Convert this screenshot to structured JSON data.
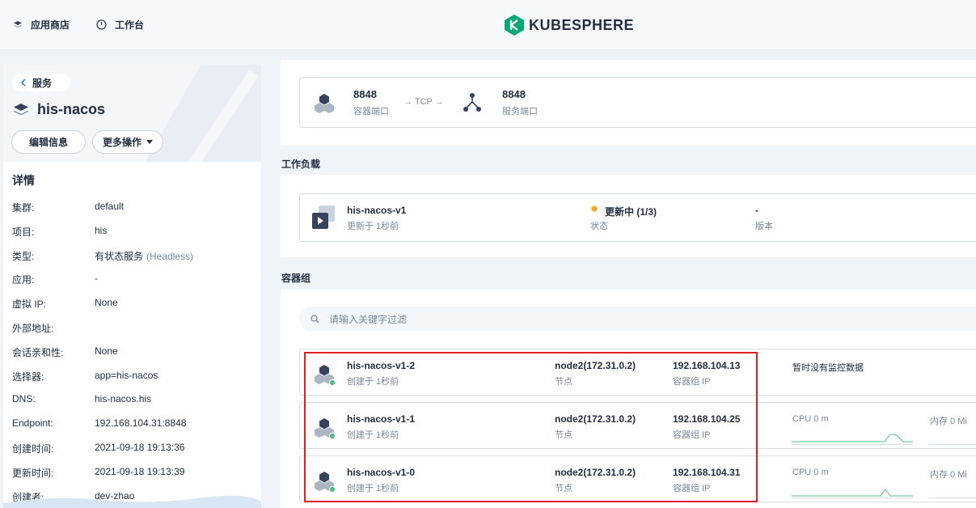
{
  "topbar": {
    "app_store": "应用商店",
    "workbench": "工作台",
    "logo_text": "KUBESPHERE",
    "icons": [
      "layers-icon",
      "dashboard-icon",
      "kubesphere-logo-icon"
    ]
  },
  "sidebar": {
    "back_label": "服务",
    "service_name": "his-nacos",
    "edit_label": "编辑信息",
    "more_label": "更多操作",
    "details_title": "详情",
    "details": [
      {
        "label": "集群:",
        "value": "default",
        "extra": ""
      },
      {
        "label": "项目:",
        "value": "his",
        "extra": ""
      },
      {
        "label": "类型:",
        "value": "有状态服务",
        "extra": "(Headless)"
      },
      {
        "label": "应用:",
        "value": "-",
        "extra": ""
      },
      {
        "label": "虚拟 IP:",
        "value": "None",
        "extra": ""
      },
      {
        "label": "外部地址:",
        "value": "",
        "extra": ""
      },
      {
        "label": "会话亲和性:",
        "value": "None",
        "extra": ""
      },
      {
        "label": "选择器:",
        "value": "app=his-nacos",
        "extra": ""
      },
      {
        "label": "DNS:",
        "value": "his-nacos.his",
        "extra": ""
      },
      {
        "label": "Endpoint:",
        "value": "192.168.104.31:8848",
        "extra": ""
      },
      {
        "label": "创建时间:",
        "value": "2021-09-18 19:13:36",
        "extra": ""
      },
      {
        "label": "更新时间:",
        "value": "2021-09-18 19:13:39",
        "extra": ""
      },
      {
        "label": "创建者:",
        "value": "dev-zhao",
        "extra": ""
      }
    ]
  },
  "ports": {
    "container_port": "8848",
    "container_port_label": "容器端口",
    "protocol": "→ TCP →",
    "service_port": "8848",
    "service_port_label": "服务端口"
  },
  "workload": {
    "section_title": "工作负载",
    "name": "his-nacos-v1",
    "updated": "更新于 1秒前",
    "status": "更新中 (1/3)",
    "status_label": "状态",
    "version": "-",
    "version_label": "版本",
    "status_color": "#f5a623"
  },
  "pods": {
    "section_title": "容器组",
    "search_placeholder": "请输入关键字过滤",
    "items": [
      {
        "name": "his-nacos-v1-2",
        "created": "创建于 1秒前",
        "node": "node2(172.31.0.2)",
        "node_label": "节点",
        "ip": "192.168.104.13",
        "ip_label": "容器组 IP",
        "monitor": "暂时没有监控数据",
        "cpu": "",
        "mem": ""
      },
      {
        "name": "his-nacos-v1-1",
        "created": "创建于 1秒前",
        "node": "node2(172.31.0.2)",
        "node_label": "节点",
        "ip": "192.168.104.25",
        "ip_label": "容器组 IP",
        "monitor": "",
        "cpu": "CPU 0 m",
        "mem": "内存 0 Mi"
      },
      {
        "name": "his-nacos-v1-0",
        "created": "创建于 1秒前",
        "node": "node2(172.31.0.2)",
        "node_label": "节点",
        "ip": "192.168.104.31",
        "ip_label": "容器组 IP",
        "monitor": "",
        "cpu": "CPU 0 m",
        "mem": "内存 0 Mi"
      }
    ],
    "status_dot_color": "#55bc8a",
    "highlight_color": "#e02020"
  }
}
